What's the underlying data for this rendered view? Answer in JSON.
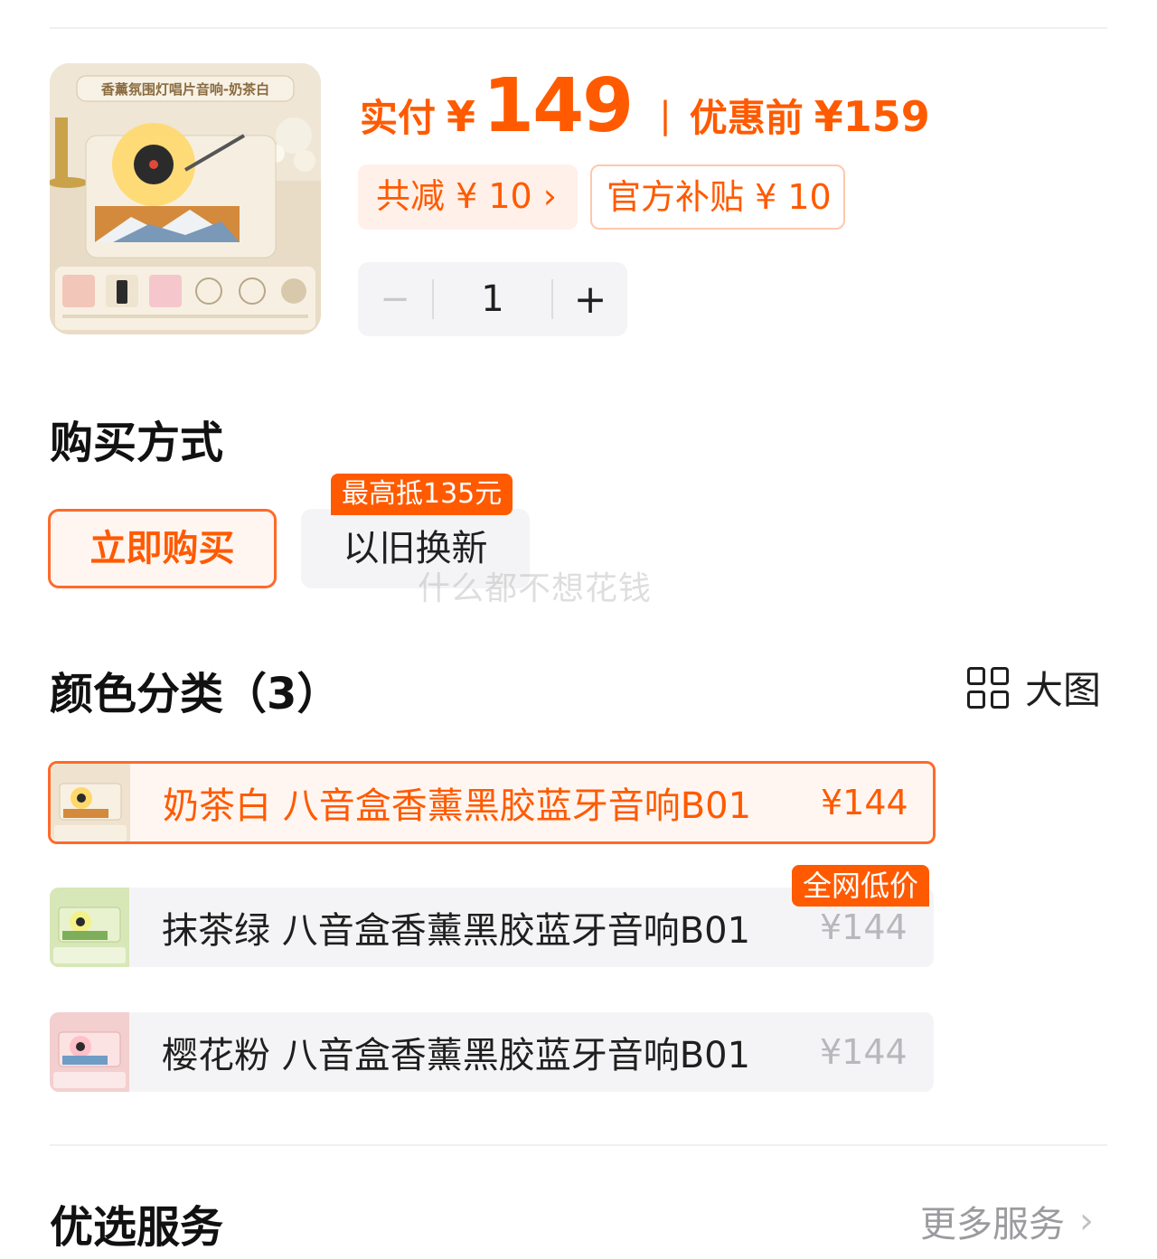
{
  "product": {
    "thumbnail_banner": "香薰氛围灯唱片音响-奶茶白",
    "price_label": "实付",
    "currency": "¥",
    "price": "149",
    "separator": "|",
    "price_before_label": "优惠前",
    "price_before": "¥159",
    "discount_chip": "共减 ¥ 10 ›",
    "subsidy_chip": "官方补贴 ¥ 10",
    "quantity": "1",
    "minus_label": "−",
    "plus_label": "+"
  },
  "purchase": {
    "title": "购买方式",
    "buy_now": "立即购买",
    "trade_in": "以旧换新",
    "trade_in_tag": "最高抵135元"
  },
  "watermark": "什么都不想花钱",
  "colors": {
    "title": "颜色分类（3）",
    "big_view": "大图",
    "variants": [
      {
        "name": "奶茶白 八音盒香薰黑胶蓝牙音响B01",
        "price": "¥144",
        "selected": true,
        "swatch": "#efe3cf"
      },
      {
        "name": "抹茶绿 八音盒香薰黑胶蓝牙音响B01",
        "price": "¥144",
        "selected": false,
        "swatch": "#d7e7b8"
      },
      {
        "name": "樱花粉 八音盒香薰黑胶蓝牙音响B01",
        "price": "¥144",
        "selected": false,
        "swatch": "#f3cfcf"
      }
    ],
    "low_price_tag": "全网低价"
  },
  "services": {
    "title": "优选服务",
    "more": "更多服务"
  },
  "theme": {
    "accent": "#ff5a00",
    "accent_light": "#fff0e9",
    "neutral_bg": "#f4f4f6"
  }
}
